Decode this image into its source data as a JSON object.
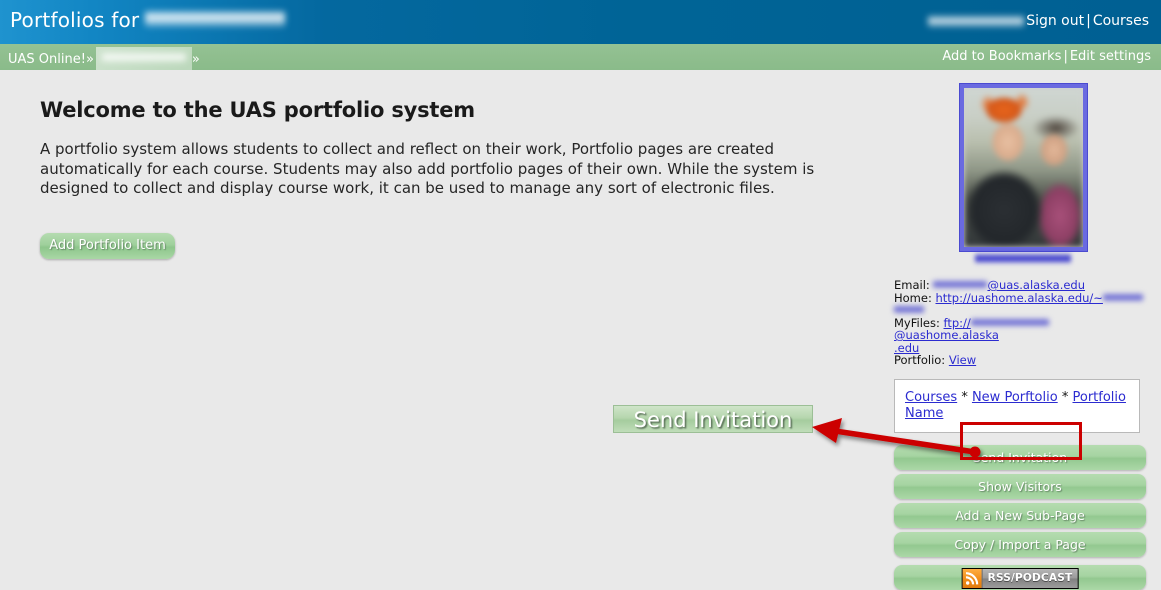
{
  "header": {
    "title_prefix": "Portfolios for",
    "title_user_redacted": true,
    "user_name_redacted": true,
    "sign_out_label": "Sign out",
    "separator": "|",
    "courses_label": "Courses"
  },
  "breadcrumb": {
    "root_label": "UAS Online!",
    "chevron": "»",
    "current_redacted": true,
    "current_chevron": "»",
    "add_bookmarks_label": "Add to Bookmarks",
    "separator": "|",
    "edit_settings_label": "Edit settings"
  },
  "main": {
    "page_title": "Welcome to the UAS portfolio system",
    "intro_paragraph": "A portfolio system allows students to collect and reflect on their work, Portfolio pages are created automatically for each course. Students may also add portfolio pages of their own. While the system is designed to collect and display course work, it can be used to manage any sort of electronic files.",
    "add_portfolio_item_label": "Add Portfolio Item"
  },
  "sidebar": {
    "avatar_alt": "user-photo",
    "avatar_caption_redacted": true,
    "contact": {
      "email_label": "Email:",
      "email_domain": "@uas.alaska.edu",
      "home_label": "Home:",
      "home_url": "http://uashome.alaska.edu/~",
      "myfiles_label": "MyFiles:",
      "myfiles_scheme": "ftp://",
      "myfiles_host": "@uashome.alaska",
      "myfiles_tld": ".edu",
      "portfolio_label": "Portfolio:",
      "portfolio_view_label": "View"
    },
    "nav_links": {
      "courses": "Courses",
      "star": "*",
      "new_portfolio": "New  Porftolio",
      "portfolio_name": "Portfolio  Name"
    },
    "buttons": [
      {
        "label": "Send Invitation",
        "highlighted": true
      },
      {
        "label": "Show Visitors",
        "highlighted": false
      },
      {
        "label": "Add a New Sub-Page",
        "highlighted": false
      },
      {
        "label": "Copy / Import a Page",
        "highlighted": false
      }
    ],
    "rss": {
      "label": "RSS/PODCAST",
      "icon": "rss-icon"
    }
  },
  "annotation": {
    "callout_label": "Send Invitation",
    "arrow_color": "#cc0000",
    "highlight_color": "#cc0000"
  },
  "colors": {
    "header_blue": "#006699",
    "breadcrumb_green": "#8fbe8e",
    "page_background": "#e9e9e9",
    "button_green": "#a6d4a2",
    "link_blue": "#2b2bd0",
    "annotation_red": "#cc0000"
  }
}
